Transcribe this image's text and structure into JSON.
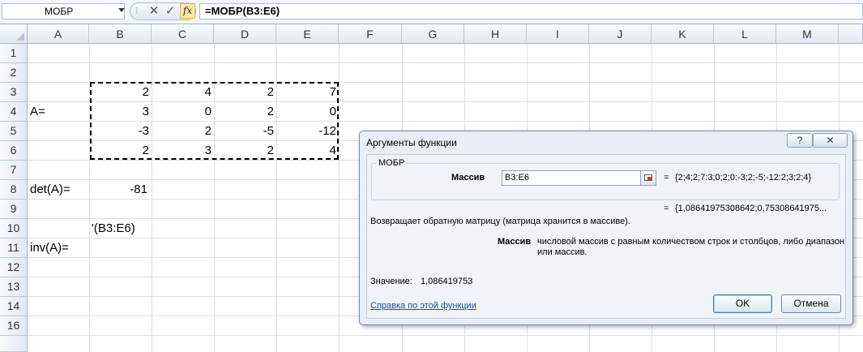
{
  "formula_bar": {
    "name_box": "МОБР",
    "dots": "⁝",
    "cancel_symbol": "✕",
    "enter_symbol": "✓",
    "fx_label": "fx",
    "formula": "=МОБР(B3:E6)"
  },
  "sheet": {
    "columns": [
      "A",
      "B",
      "C",
      "D",
      "E",
      "F",
      "G",
      "H",
      "I",
      "J",
      "K",
      "L",
      "M"
    ],
    "rows": [
      "1",
      "2",
      "3",
      "4",
      "5",
      "6",
      "7",
      "8",
      "9",
      "10",
      "11",
      "12",
      "13",
      "14",
      "16"
    ],
    "matrix": [
      [
        "2",
        "4",
        "2",
        "7"
      ],
      [
        "3",
        "0",
        "2",
        "0"
      ],
      [
        "-3",
        "2",
        "-5",
        "-12"
      ],
      [
        "2",
        "3",
        "2",
        "4"
      ]
    ],
    "label_a": "A=",
    "label_det": "det(A)=",
    "det_value": "-81",
    "editing_text": "'(B3:E6)",
    "label_inv": "inv(A)="
  },
  "dialog": {
    "title": "Аргументы функции",
    "help_btn": "?",
    "close_btn": "✕",
    "function_name": "МОБР",
    "arg_label": "Массив",
    "arg_value": "B3:E6",
    "arg_eq": "=",
    "arg_preview": "{2;4;2;7:3;0;2;0:-3;2;-5;-12:2;3;2;4}",
    "result_eq": "=",
    "result_preview": "{1,08641975308642;0,75308641975...",
    "description": "Возвращает обратную матрицу (матрица хранится в массиве).",
    "arg_desc_name": "Массив",
    "arg_desc_text": "числовой массив с равным количеством строк и столбцов, либо диапазон или массив.",
    "value_label": "Значение:",
    "value": "1,086419753",
    "help_link": "Справка по этой функции",
    "ok": "OK",
    "cancel": "Отмена"
  }
}
